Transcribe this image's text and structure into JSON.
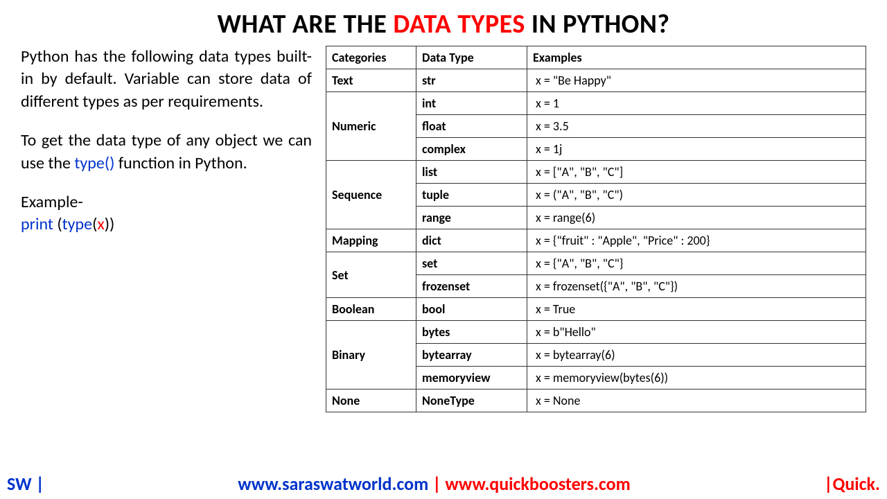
{
  "title": {
    "part1": "WHAT ARE THE ",
    "highlight": "DATA TYPES",
    "part2": " IN PYTHON?"
  },
  "left": {
    "para1": "Python has the following data types built-in by default. Variable can store data of different types as per requirements.",
    "para2_a": "To get the data type of any object we can use the ",
    "para2_type": "type()",
    "para2_b": " function in Python.",
    "example_label": "Example-",
    "example_print": "print ",
    "example_open": "(",
    "example_type": "type",
    "example_open2": "(",
    "example_x": "x",
    "example_close": "))"
  },
  "table": {
    "headers": [
      "Categories",
      "Data Type",
      "Examples"
    ],
    "rows": [
      {
        "cat": "Text",
        "types": [
          {
            "dtype": "str",
            "ex": "x = \"Be Happy\""
          }
        ]
      },
      {
        "cat": "Numeric",
        "types": [
          {
            "dtype": "int",
            "ex": "x = 1"
          },
          {
            "dtype": "float",
            "ex": "x = 3.5"
          },
          {
            "dtype": "complex",
            "ex": "x = 1j"
          }
        ]
      },
      {
        "cat": "Sequence",
        "types": [
          {
            "dtype": "list",
            "ex": "x = [\"A\", \"B\", \"C\"]"
          },
          {
            "dtype": "tuple",
            "ex": "x = (\"A\", \"B\", \"C\")"
          },
          {
            "dtype": "range",
            "ex": "x = range(6)"
          }
        ]
      },
      {
        "cat": "Mapping",
        "types": [
          {
            "dtype": "dict",
            "ex": "x = {\"fruit\" : \"Apple\", \"Price\" : 200}"
          }
        ]
      },
      {
        "cat": "Set",
        "types": [
          {
            "dtype": "set",
            "ex": "x = {\"A\", \"B\", \"C\"}"
          },
          {
            "dtype": "frozenset",
            "ex": "x = frozenset({\"A\", \"B\", \"C\"})"
          }
        ]
      },
      {
        "cat": "Boolean",
        "types": [
          {
            "dtype": "bool",
            "ex": "x = True"
          }
        ]
      },
      {
        "cat": "Binary",
        "types": [
          {
            "dtype": "bytes",
            "ex": "x = b\"Hello\""
          },
          {
            "dtype": "bytearray",
            "ex": "x = bytearray(6)"
          },
          {
            "dtype": "memoryview",
            "ex": "x = memoryview(bytes(6))"
          }
        ]
      },
      {
        "cat": "None",
        "types": [
          {
            "dtype": "NoneType",
            "ex": "x = None"
          }
        ]
      }
    ]
  },
  "footer": {
    "sw": "SW |",
    "url1": "www.saraswatworld.com",
    "sep": " | ",
    "url2": "www.quickboosters.com",
    "quick": "|Quick."
  }
}
